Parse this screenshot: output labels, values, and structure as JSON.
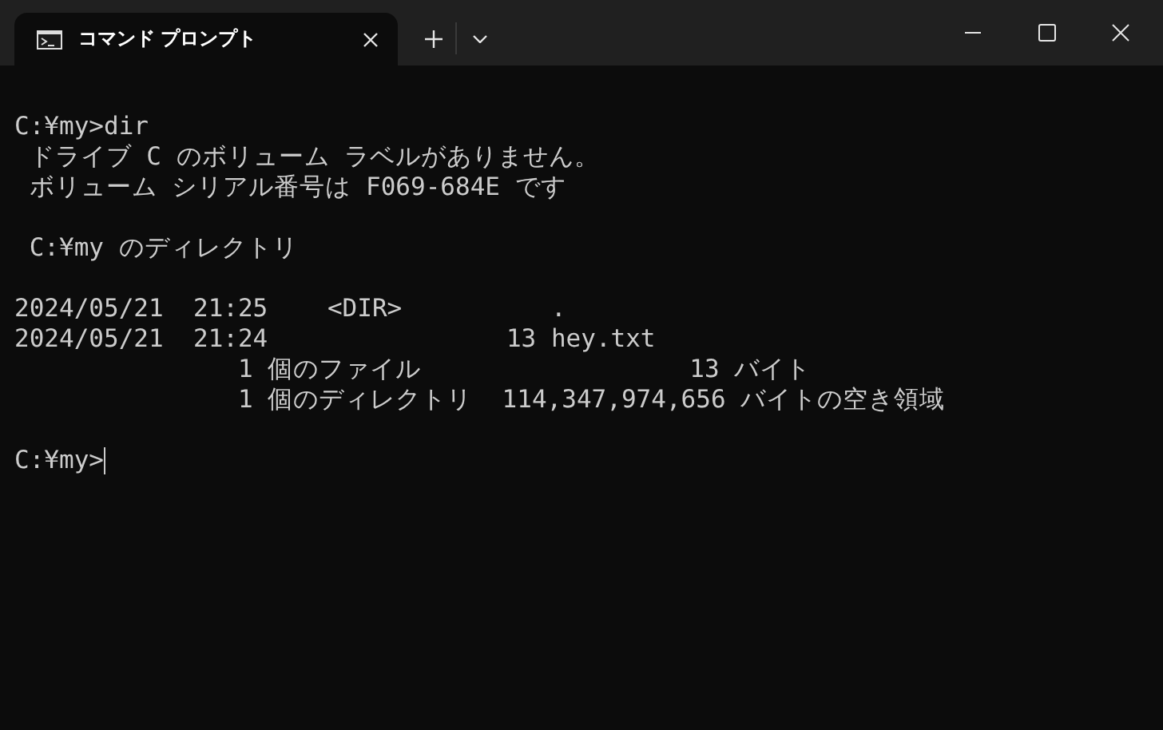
{
  "window": {
    "tabs": [
      {
        "title": "コマンド プロンプト",
        "selected": true
      }
    ]
  },
  "console": {
    "blocks": [
      [
        "C:¥my>dir",
        " ドライブ C のボリューム ラベルがありません。",
        " ボリューム シリアル番号は F069-684E です"
      ],
      [
        " C:¥my のディレクトリ"
      ],
      [
        "2024/05/21  21:25    <DIR>          .",
        "2024/05/21  21:24                13 hey.txt",
        "               1 個のファイル                  13 バイト",
        "               1 個のディレクトリ  114,347,974,656 バイトの空き領域"
      ]
    ],
    "prompt": "C:¥my>"
  }
}
